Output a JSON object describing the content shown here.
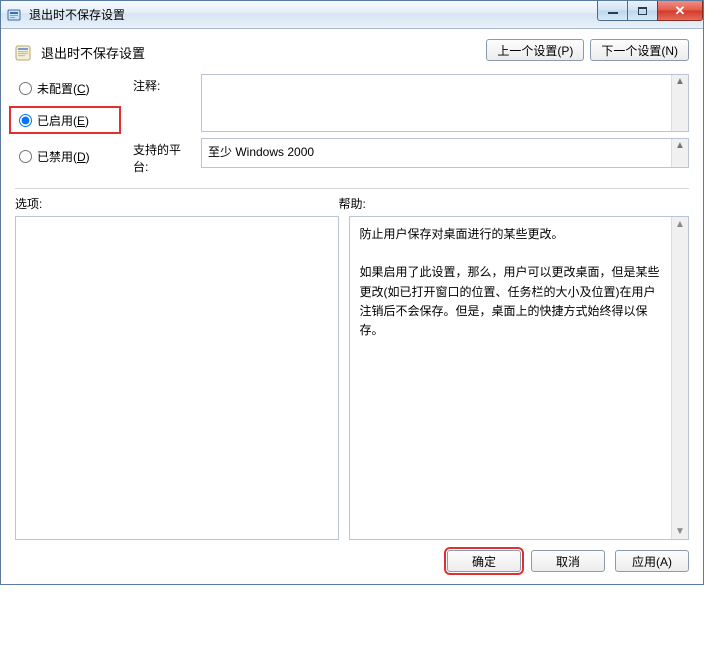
{
  "window": {
    "title": "退出时不保存设置"
  },
  "header": {
    "policy_title": "退出时不保存设置",
    "prev_btn": "上一个设置(P)",
    "next_btn": "下一个设置(N)"
  },
  "radios": {
    "not_configured": {
      "label": "未配置(",
      "accel": "C",
      "tail": ")",
      "checked": false
    },
    "enabled": {
      "label": "已启用(",
      "accel": "E",
      "tail": ")",
      "checked": true
    },
    "disabled": {
      "label": "已禁用(",
      "accel": "D",
      "tail": ")",
      "checked": false
    }
  },
  "labels": {
    "comment": "注释:",
    "platform": "支持的平台:",
    "options": "选项:",
    "help": "帮助:"
  },
  "comment_text": "",
  "platform_text": "至少 Windows 2000",
  "help": {
    "p1": "防止用户保存对桌面进行的某些更改。",
    "p2": "如果启用了此设置，那么，用户可以更改桌面，但是某些更改(如已打开窗口的位置、任务栏的大小及位置)在用户注销后不会保存。但是，桌面上的快捷方式始终得以保存。"
  },
  "footer": {
    "ok": "确定",
    "cancel": "取消",
    "apply": "应用(A)"
  },
  "icons": {
    "app": "policy-editor-icon",
    "policy": "policy-item-icon"
  }
}
